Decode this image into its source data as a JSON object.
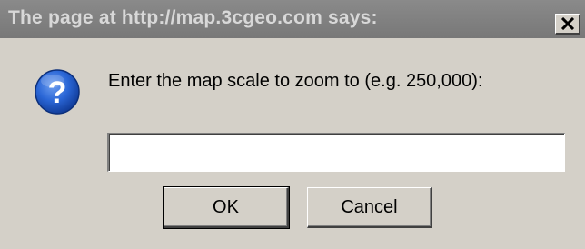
{
  "dialog": {
    "title": "The page at http://map.3cgeo.com says:",
    "close_glyph": "X",
    "icon": "question-icon",
    "prompt": "Enter the map scale to zoom to (e.g. 250,000):",
    "input_value": "",
    "ok_label": "OK",
    "cancel_label": "Cancel"
  },
  "colors": {
    "titlebar_inactive": "#808080",
    "titlebar_text": "#d8d8d8",
    "dialog_face": "#d4d0c8",
    "icon_blue": "#1f5fd0"
  }
}
